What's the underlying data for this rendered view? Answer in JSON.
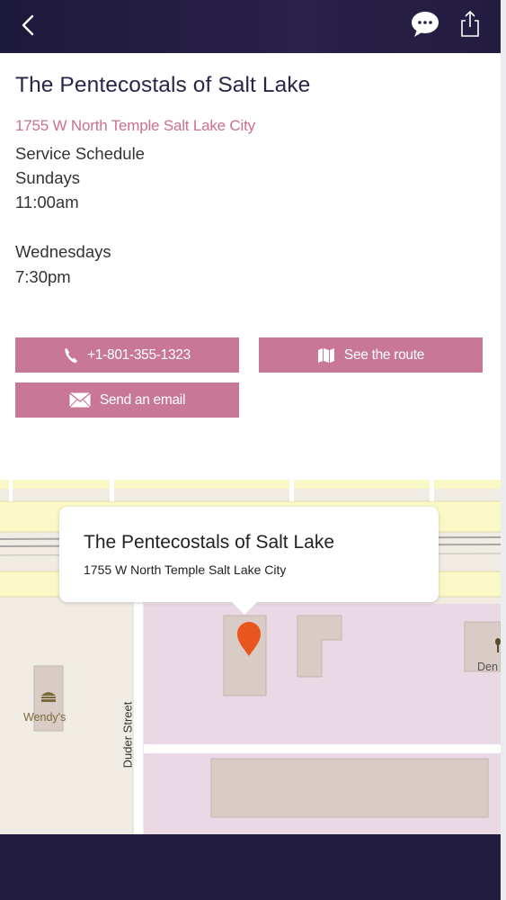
{
  "header": {
    "back_icon": "chevron-left-icon",
    "chat_icon": "chat-bubble-icon",
    "share_icon": "share-icon"
  },
  "place": {
    "name": "The Pentecostals of Salt Lake",
    "address": "1755 W North Temple Salt Lake City"
  },
  "schedule": {
    "heading": "Service Schedule",
    "day1": "Sundays",
    "time1": "11:00am",
    "day2": "Wednesdays",
    "time2": "7:30pm"
  },
  "actions": {
    "phone_label": "+1-801-355-1323",
    "route_label": "See the route",
    "email_label": "Send an email"
  },
  "map": {
    "callout_title": "The Pentecostals of Salt Lake",
    "callout_address": "1755 W North Temple Salt Lake City",
    "poi_wendys": "Wendy's",
    "street_label": "Duder Street",
    "poi_den": "Den"
  },
  "colors": {
    "header": "#221c3e",
    "accent": "#c87896",
    "address_text": "#c9708f",
    "map_pin": "#e8561e"
  }
}
